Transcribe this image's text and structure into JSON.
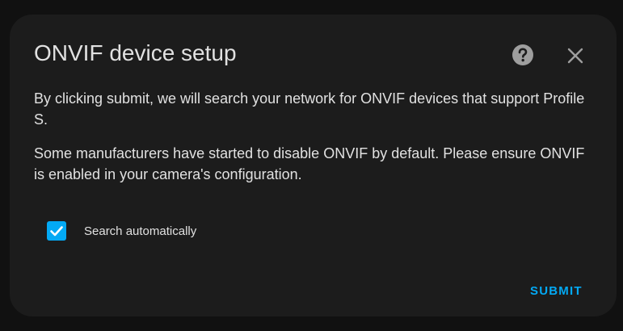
{
  "dialog": {
    "title": "ONVIF device setup",
    "help_icon": "help-circle-icon",
    "close_icon": "close-icon",
    "paragraphs": [
      "By clicking submit, we will search your network for ONVIF devices that support Profile S.",
      "Some manufacturers have started to disable ONVIF by default. Please ensure ONVIF is enabled in your camera's configuration."
    ],
    "checkbox": {
      "label": "Search automatically",
      "checked": true
    },
    "submit_label": "SUBMIT"
  },
  "colors": {
    "accent": "#03a9f4",
    "dialog_bg": "#1c1c1c",
    "page_bg": "#111111",
    "text": "#e1e1e1",
    "icon": "#9e9e9e"
  }
}
